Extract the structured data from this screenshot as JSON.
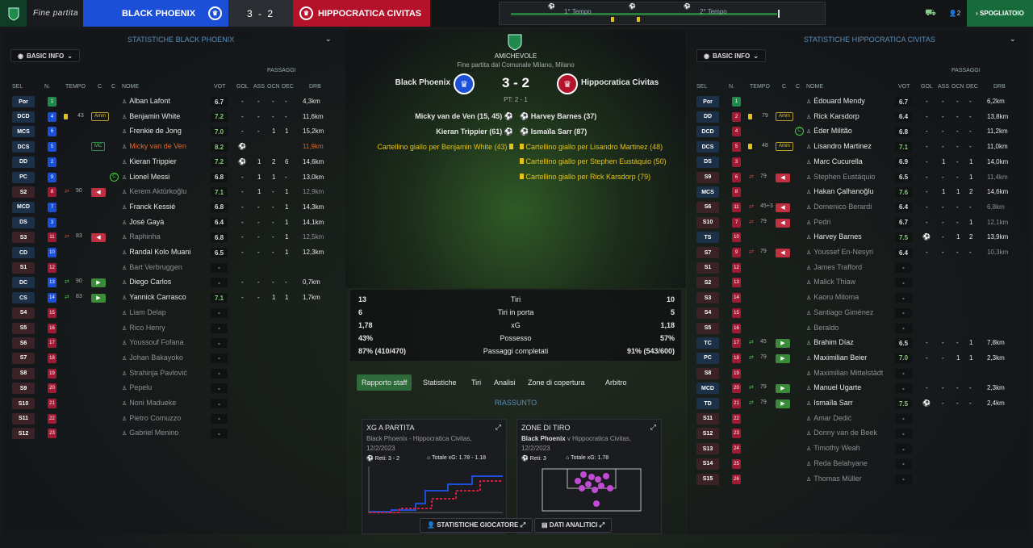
{
  "topbar": {
    "status": "Fine partita",
    "home": "BLACK PHOENIX",
    "score": "3 - 2",
    "away": "HIPPOCRATICA CIVITAS",
    "t1": "1° Tempo",
    "t2": "2° Tempo",
    "count": "2",
    "dressing": "SPOGLIATOIO"
  },
  "left": {
    "title": "STATISTICHE BLACK PHOENIX",
    "basic": "BASIC INFO"
  },
  "right": {
    "title": "STATISTICHE HIPPOCRATICA CIVITAS",
    "basic": "BASIC INFO"
  },
  "headers": {
    "sel": "SEL",
    "n": "N.",
    "tempo": "TEMPO",
    "c": "C",
    "nome": "NOME",
    "vot": "VOT",
    "gol": "GOL",
    "ass": "ASS",
    "ocn": "OCN",
    "dec": "DEC",
    "drb": "DRB",
    "passaggi": "PASSAGGI"
  },
  "match": {
    "competition": "AMICHEVOLE",
    "venue": "Fine partita dal Comunale Milano, Milano",
    "home": "Black Phoenix",
    "away": "Hippocratica Civitas",
    "score": "3 - 2",
    "ht": "PT: 2 - 1"
  },
  "events": {
    "home": [
      "Micky van de Ven (15, 45)",
      "Kieran Trippier (61)",
      "Cartellino giallo per Benjamin White (43)"
    ],
    "away": [
      "Harvey Barnes (37)",
      "Ismaïla Sarr (87)",
      "Cartellino giallo per Lisandro Martinez (48)",
      "Cartellino giallo per Stephen Eustáquio (50)",
      "Cartellino giallo per Rick Karsdorp (79)"
    ]
  },
  "stats": [
    {
      "h": "13",
      "l": "Tiri",
      "a": "10"
    },
    {
      "h": "6",
      "l": "Tiri in porta",
      "a": "5"
    },
    {
      "h": "1,78",
      "l": "xG",
      "a": "1,18"
    },
    {
      "h": "43%",
      "l": "Possesso",
      "a": "57%"
    },
    {
      "h": "87% (410/470)",
      "l": "Passaggi completati",
      "a": "91% (543/600)"
    }
  ],
  "tabs": [
    "Rapporto staff",
    "Statistiche",
    "Tiri",
    "Analisi",
    "Zone di copertura",
    "Arbitro"
  ],
  "summary": "RIASSUNTO",
  "xgcard": {
    "title": "XG A PARTITA",
    "sub": "Black Phoenix - Hippocratica Civitas, 12/2/2023",
    "goals": "Reti: 3 - 2",
    "xg": "Totale xG: 1.78 - 1.18"
  },
  "shotcard": {
    "title": "ZONE DI TIRO",
    "team": "Black Phoenix",
    "sub": "v Hippocratica Civitas, 12/2/2023",
    "goals": "Reti: 3",
    "xg": "Totale xG: 1.78"
  },
  "buttons": {
    "players": "STATISTICHE GIOCATORE",
    "analytics": "DATI ANALITICI"
  },
  "home_players": [
    {
      "pos": "Por",
      "n": "1",
      "name": "Alban Lafont",
      "vot": "6.7",
      "gol": "-",
      "ass": "-",
      "ocn": "-",
      "dec": "-",
      "drb": "4,3km"
    },
    {
      "pos": "DCD",
      "n": "4",
      "name": "Benjamin White",
      "vot": "7.2",
      "gol": "-",
      "ass": "-",
      "ocn": "-",
      "dec": "-",
      "drb": "11,6km",
      "tm": "43",
      "amm": "Amm"
    },
    {
      "pos": "MCS",
      "n": "6",
      "name": "Frenkie de Jong",
      "vot": "7.0",
      "gol": "-",
      "ass": "-",
      "ocn": "1",
      "dec": "1",
      "drb": "15,2km"
    },
    {
      "pos": "DCS",
      "n": "5",
      "name": "Micky van de Ven",
      "vot": "8.2",
      "gol": "2",
      "ass": "",
      "ocn": "",
      "dec": "",
      "drb": "11,9km",
      "mic": "MC",
      "hl": true
    },
    {
      "pos": "DD",
      "n": "2",
      "name": "Kieran Trippier",
      "vot": "7.2",
      "gol": "1",
      "ass": "1",
      "ocn": "2",
      "dec": "6",
      "drb": "14,6km"
    },
    {
      "pos": "PC",
      "n": "9",
      "name": "Lionel Messi",
      "vot": "6.8",
      "gol": "-",
      "ass": "1",
      "ocn": "1",
      "dec": "-",
      "drb": "13,0km",
      "c": "C"
    },
    {
      "pos": "S2",
      "n": "8",
      "name": "Kerem Aktürkoğlu",
      "vot": "7.1",
      "gol": "-",
      "ass": "1",
      "ocn": "-",
      "dec": "1",
      "drb": "12,9km",
      "tm": "90",
      "out": true,
      "dim": true
    },
    {
      "pos": "MCD",
      "n": "7",
      "name": "Franck Kessié",
      "vot": "6.8",
      "gol": "-",
      "ass": "-",
      "ocn": "-",
      "dec": "1",
      "drb": "14,3km"
    },
    {
      "pos": "DS",
      "n": "3",
      "name": "José Gayà",
      "vot": "6.4",
      "gol": "-",
      "ass": "-",
      "ocn": "-",
      "dec": "1",
      "drb": "14,1km"
    },
    {
      "pos": "S3",
      "n": "11",
      "name": "Raphinha",
      "vot": "6.8",
      "gol": "-",
      "ass": "-",
      "ocn": "-",
      "dec": "1",
      "drb": "12,5km",
      "tm": "83",
      "out": true,
      "dim": true
    },
    {
      "pos": "CD",
      "n": "10",
      "name": "Randal Kolo Muani",
      "vot": "6.5",
      "gol": "-",
      "ass": "-",
      "ocn": "-",
      "dec": "1",
      "drb": "12,3km"
    },
    {
      "pos": "S1",
      "n": "12",
      "name": "Bart Verbruggen",
      "vot": "-",
      "dim": true
    },
    {
      "pos": "DC",
      "n": "13",
      "name": "Diego Carlos",
      "vot": "-",
      "gol": "-",
      "ass": "-",
      "ocn": "-",
      "dec": "-",
      "drb": "0,7km",
      "tm": "90",
      "in": true
    },
    {
      "pos": "CS",
      "n": "14",
      "name": "Yannick Carrasco",
      "vot": "7.1",
      "gol": "-",
      "ass": "-",
      "ocn": "1",
      "dec": "1",
      "drb": "1,7km",
      "tm": "83",
      "in": true
    },
    {
      "pos": "S4",
      "n": "15",
      "name": "Liam Delap",
      "vot": "-",
      "dim": true
    },
    {
      "pos": "S5",
      "n": "16",
      "name": "Rico Henry",
      "vot": "-",
      "dim": true
    },
    {
      "pos": "S6",
      "n": "17",
      "name": "Youssouf Fofana",
      "vot": "-",
      "dim": true
    },
    {
      "pos": "S7",
      "n": "18",
      "name": "Johan Bakayoko",
      "vot": "-",
      "dim": true
    },
    {
      "pos": "S8",
      "n": "19",
      "name": "Strahinja Pavlović",
      "vot": "-",
      "dim": true
    },
    {
      "pos": "S9",
      "n": "20",
      "name": "Pepelu",
      "vot": "-",
      "dim": true
    },
    {
      "pos": "S10",
      "n": "21",
      "name": "Noni Madueke",
      "vot": "-",
      "dim": true
    },
    {
      "pos": "S11",
      "n": "22",
      "name": "Pietro Comuzzo",
      "vot": "-",
      "dim": true
    },
    {
      "pos": "S12",
      "n": "23",
      "name": "Gabriel Menino",
      "vot": "-",
      "dim": true
    }
  ],
  "away_players": [
    {
      "pos": "Por",
      "n": "1",
      "name": "Édouard Mendy",
      "vot": "6.7",
      "gol": "-",
      "ass": "-",
      "ocn": "-",
      "dec": "-",
      "drb": "6,2km"
    },
    {
      "pos": "DD",
      "n": "2",
      "name": "Rick Karsdorp",
      "vot": "6.4",
      "gol": "-",
      "ass": "-",
      "ocn": "-",
      "dec": "-",
      "drb": "13,8km",
      "tm": "79",
      "amm": "Amm"
    },
    {
      "pos": "DCD",
      "n": "4",
      "name": "Éder Militão",
      "vot": "6.8",
      "gol": "-",
      "ass": "-",
      "ocn": "-",
      "dec": "-",
      "drb": "11,2km",
      "c": "C"
    },
    {
      "pos": "DCS",
      "n": "5",
      "name": "Lisandro Martinez",
      "vot": "7.1",
      "gol": "-",
      "ass": "-",
      "ocn": "-",
      "dec": "-",
      "drb": "11,0km",
      "tm": "48",
      "amm": "Amm"
    },
    {
      "pos": "DS",
      "n": "3",
      "name": "Marc Cucurella",
      "vot": "6.9",
      "gol": "-",
      "ass": "1",
      "ocn": "-",
      "dec": "1",
      "drb": "14,0km"
    },
    {
      "pos": "S9",
      "n": "6",
      "name": "Stephen Eustáquio",
      "vot": "6.5",
      "gol": "-",
      "ass": "-",
      "ocn": "-",
      "dec": "1",
      "drb": "11,4km",
      "tm": "79",
      "out": true,
      "dim": true
    },
    {
      "pos": "MCS",
      "n": "8",
      "name": "Hakan Çalhanoğlu",
      "vot": "7.6",
      "gol": "-",
      "ass": "1",
      "ocn": "1",
      "dec": "2",
      "drb": "14,6km"
    },
    {
      "pos": "S6",
      "n": "11",
      "name": "Domenico Berardi",
      "vot": "6.4",
      "gol": "-",
      "ass": "-",
      "ocn": "-",
      "dec": "-",
      "drb": "6,8km",
      "tm": "45+3",
      "out": true,
      "dim": true
    },
    {
      "pos": "S10",
      "n": "7",
      "name": "Pedri",
      "vot": "6.7",
      "gol": "-",
      "ass": "-",
      "ocn": "-",
      "dec": "1",
      "drb": "12,1km",
      "tm": "79",
      "out": true,
      "dim": true
    },
    {
      "pos": "TS",
      "n": "10",
      "name": "Harvey Barnes",
      "vot": "7.5",
      "gol": "1",
      "ass": "-",
      "ocn": "1",
      "dec": "2",
      "drb": "13,9km"
    },
    {
      "pos": "S7",
      "n": "9",
      "name": "Youssef En-Nesyri",
      "vot": "6.4",
      "gol": "-",
      "ass": "-",
      "ocn": "-",
      "dec": "-",
      "drb": "10,3km",
      "tm": "79",
      "out": true,
      "dim": true
    },
    {
      "pos": "S1",
      "n": "12",
      "name": "James Trafford",
      "vot": "-",
      "dim": true
    },
    {
      "pos": "S2",
      "n": "13",
      "name": "Malick Thiaw",
      "vot": "-",
      "dim": true
    },
    {
      "pos": "S3",
      "n": "14",
      "name": "Kaoru Mitoma",
      "vot": "-",
      "dim": true
    },
    {
      "pos": "S4",
      "n": "15",
      "name": "Santiago Giménez",
      "vot": "-",
      "dim": true
    },
    {
      "pos": "S5",
      "n": "16",
      "name": "Beraldo",
      "vot": "-",
      "dim": true
    },
    {
      "pos": "TC",
      "n": "17",
      "name": "Brahim Díaz",
      "vot": "6.5",
      "gol": "-",
      "ass": "-",
      "ocn": "-",
      "dec": "1",
      "drb": "7,8km",
      "tm": "45",
      "in": true
    },
    {
      "pos": "PC",
      "n": "18",
      "name": "Maximilian Beier",
      "vot": "7.0",
      "gol": "-",
      "ass": "-",
      "ocn": "1",
      "dec": "1",
      "drb": "2,3km",
      "tm": "79",
      "in": true
    },
    {
      "pos": "S8",
      "n": "19",
      "name": "Maximilian Mittelstädt",
      "vot": "-",
      "dim": true
    },
    {
      "pos": "MCD",
      "n": "20",
      "name": "Manuel Ugarte",
      "vot": "-",
      "gol": "-",
      "ass": "-",
      "ocn": "-",
      "dec": "-",
      "drb": "2,3km",
      "tm": "79",
      "in": true
    },
    {
      "pos": "TD",
      "n": "21",
      "name": "Ismaïla Sarr",
      "vot": "7.5",
      "gol": "1",
      "ass": "-",
      "ocn": "-",
      "dec": "-",
      "drb": "2,4km",
      "tm": "79",
      "in": true
    },
    {
      "pos": "S11",
      "n": "22",
      "name": "Amar Dedić",
      "vot": "-",
      "dim": true
    },
    {
      "pos": "S12",
      "n": "23",
      "name": "Donny van de Beek",
      "vot": "-",
      "dim": true
    },
    {
      "pos": "S13",
      "n": "24",
      "name": "Timothy Weah",
      "vot": "-",
      "dim": true
    },
    {
      "pos": "S14",
      "n": "25",
      "name": "Reda Belahyane",
      "vot": "-",
      "dim": true
    },
    {
      "pos": "S15",
      "n": "26",
      "name": "Thomas Müller",
      "vot": "-",
      "dim": true
    }
  ]
}
